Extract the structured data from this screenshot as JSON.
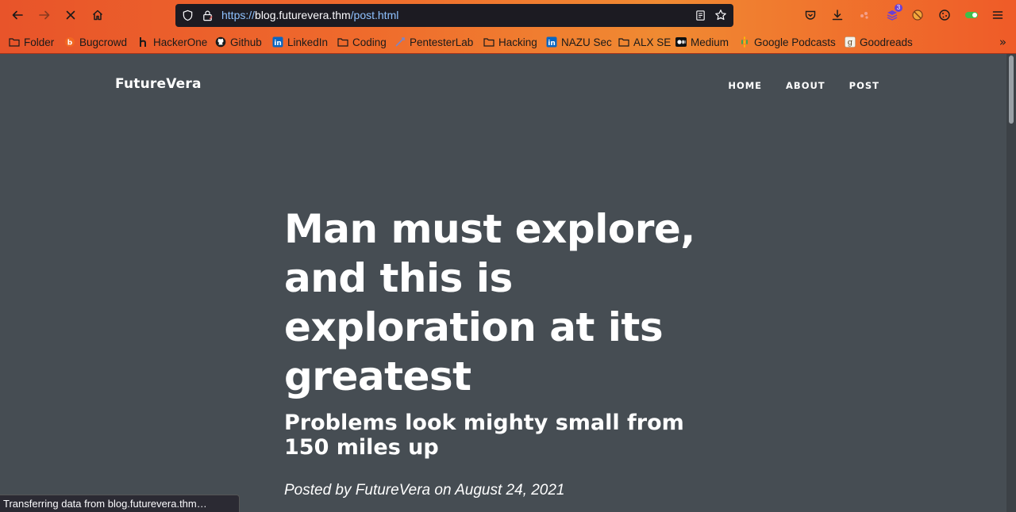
{
  "browser": {
    "url_prefix": "https://",
    "url_host": "blog.futurevera.thm",
    "url_path": "/post.html",
    "extension_badge": "3",
    "bookmarks": [
      {
        "label": "Folder",
        "icon": "folder-icon"
      },
      {
        "label": "Bugcrowd",
        "icon": "bugcrowd-icon"
      },
      {
        "label": "HackerOne",
        "icon": "hackerone-icon"
      },
      {
        "label": "Github",
        "icon": "github-icon"
      },
      {
        "label": "LinkedIn",
        "icon": "linkedin-icon"
      },
      {
        "label": "Coding",
        "icon": "folder-icon"
      },
      {
        "label": "PentesterLab",
        "icon": "pentesterlab-icon"
      },
      {
        "label": "Hacking",
        "icon": "folder-icon"
      },
      {
        "label": "NAZU Sec",
        "icon": "linkedin-icon"
      },
      {
        "label": "ALX SE",
        "icon": "folder-icon"
      },
      {
        "label": "Medium",
        "icon": "medium-icon"
      },
      {
        "label": "Google Podcasts",
        "icon": "google-podcasts-icon"
      },
      {
        "label": "Goodreads",
        "icon": "goodreads-icon"
      }
    ],
    "more_bookmarks": "»",
    "status_text": "Transferring data from blog.futurevera.thm…"
  },
  "site": {
    "brand": "FutureVera",
    "nav": {
      "home": "HOME",
      "about": "ABOUT",
      "post": "POST"
    }
  },
  "post": {
    "title": "Man must explore, and this is exploration at its greatest",
    "subtitle": "Problems look mighty small from 150 miles up",
    "meta": "Posted by FutureVera on August 24, 2021"
  },
  "colors": {
    "chrome_gradient_start": "#e8542a",
    "chrome_gradient_end": "#ef5b28",
    "page_background": "#464d53",
    "url_field": "#1c1b22"
  }
}
